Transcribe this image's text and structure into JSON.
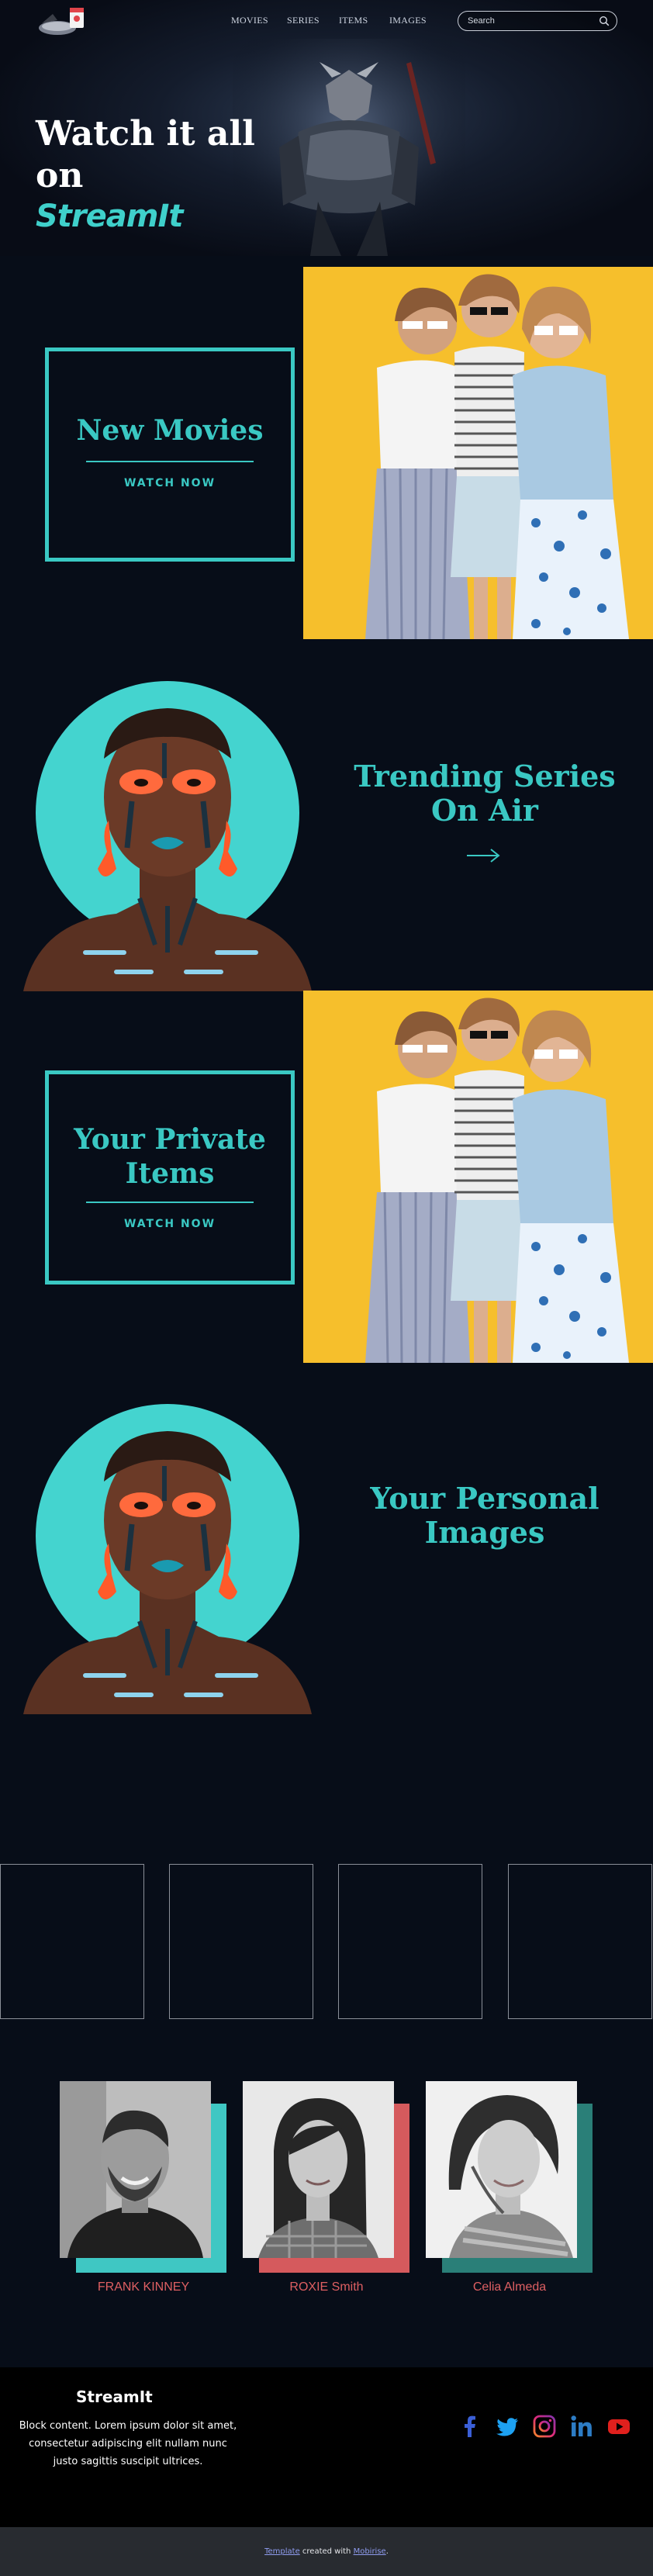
{
  "nav": {
    "links": [
      "MOVIES",
      "SERIES",
      "ITEMS",
      "IMAGES"
    ],
    "search_placeholder": "Search"
  },
  "hero": {
    "line1": "Watch it all",
    "line2": "on",
    "brand": "StreamIt"
  },
  "sections": {
    "new_movies": {
      "title": "New Movies",
      "cta": "WATCH NOW"
    },
    "trending": {
      "title_line1": "Trending Series",
      "title_line2": "On Air"
    },
    "private_items": {
      "title_line1": "Your Private",
      "title_line2": "Items",
      "cta": "WATCH NOW"
    },
    "personal_images": {
      "title_line1": "Your Personal",
      "title_line2": "Images"
    }
  },
  "team": [
    {
      "name": "FRANK KINNEY",
      "shadow_color": "#3fc7c3"
    },
    {
      "name": "ROXIE Smith",
      "shadow_color": "#d55a5d"
    },
    {
      "name": "Celia Almeda",
      "shadow_color": "#2a7f78"
    }
  ],
  "footer": {
    "brand": "StreamIt",
    "text": "Block content. Lorem ipsum dolor sit amet, consectetur adipiscing elit nullam nunc justo sagittis suscipit ultrices.",
    "social_icons": [
      "facebook-icon",
      "twitter-icon",
      "instagram-icon",
      "linkedin-icon",
      "youtube-icon"
    ]
  },
  "copyright": {
    "link1": "Template",
    "middle": " created with ",
    "link2": "Mobirise",
    "end": "."
  },
  "colors": {
    "accent": "#3ac8c3",
    "coral": "#de5f62",
    "background": "#070d18"
  }
}
